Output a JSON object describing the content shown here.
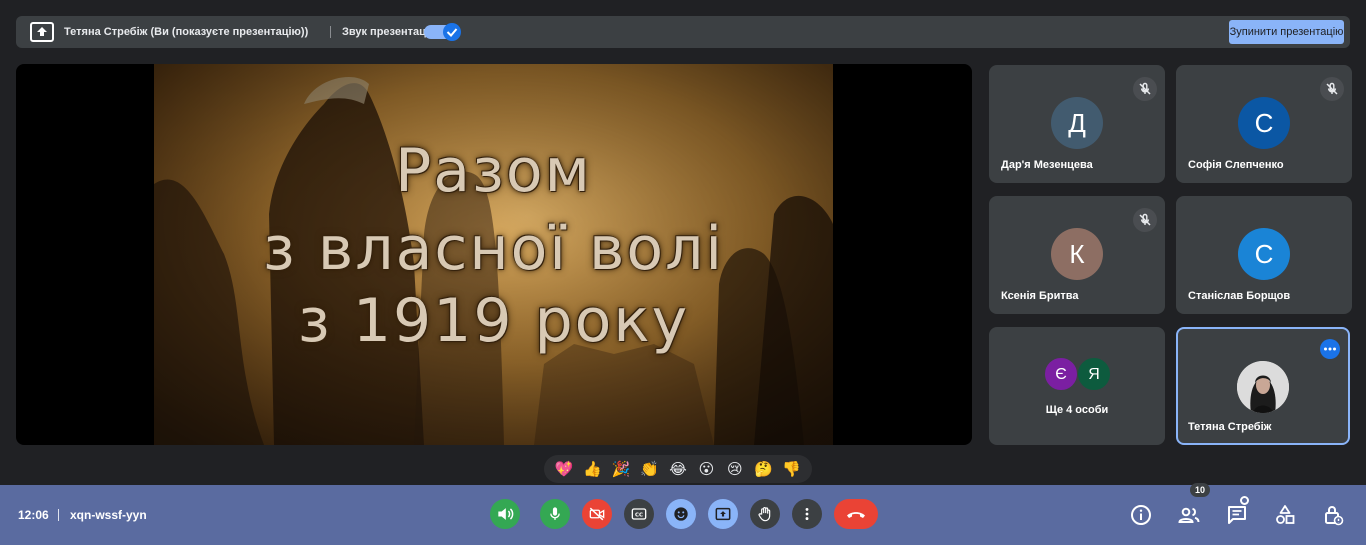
{
  "topbar": {
    "presenter_label": "Тетяна Стребіж (Ви (показуєте презентацію))",
    "sound_label": "Звук презентації",
    "sound_on": true,
    "stop_label": "Зупинити презентацію"
  },
  "slide": {
    "line1": "Разом",
    "line2": "з власної волі",
    "line3": "з 1919 року"
  },
  "participants": [
    {
      "initial": "Д",
      "name": "Дар'я Мезенцева",
      "avatar_color": "#425b6f",
      "muted": true
    },
    {
      "initial": "С",
      "name": "Софія Слепченко",
      "avatar_color": "#0b57a4",
      "muted": true
    },
    {
      "initial": "К",
      "name": "Ксенія Бритва",
      "avatar_color": "#8d6e63",
      "muted": true
    },
    {
      "initial": "С",
      "name": "Станіслав Борщов",
      "avatar_color": "#1a84d6",
      "muted": false
    }
  ],
  "more_tile": {
    "avatars": [
      {
        "initial": "Є",
        "color": "#7b1fa2"
      },
      {
        "initial": "Я",
        "color": "#0d5b3e"
      }
    ],
    "label": "Ще 4 особи"
  },
  "self_tile": {
    "name": "Тетяна Стребіж",
    "menu_icon": "more-horizontal-icon"
  },
  "reactions": [
    "💖",
    "👍",
    "🎉",
    "👏",
    "😂",
    "😮",
    "😢",
    "🤔",
    "👎"
  ],
  "bottombar": {
    "time": "12:06",
    "meeting_code": "xqn-wssf-yyn",
    "people_count": "10",
    "controls": [
      {
        "name": "speaker-button",
        "icon": "speaker-icon"
      },
      {
        "name": "mic-button",
        "icon": "mic-icon"
      },
      {
        "name": "camera-button",
        "icon": "camera-off-icon"
      },
      {
        "name": "captions-button",
        "icon": "captions-icon"
      },
      {
        "name": "reactions-button",
        "icon": "smiley-icon"
      },
      {
        "name": "present-button",
        "icon": "present-icon"
      },
      {
        "name": "raise-hand-button",
        "icon": "hand-icon"
      },
      {
        "name": "more-options-button",
        "icon": "more-vertical-icon"
      },
      {
        "name": "leave-call-button",
        "icon": "hang-up-icon"
      }
    ],
    "right_icons": [
      "info-icon",
      "people-icon",
      "chat-icon",
      "activities-icon",
      "host-controls-icon"
    ]
  },
  "colors": {
    "accent": "#8ab4f8",
    "bottom_bar": "#5a6ba0",
    "leave": "#ea4335",
    "speaker": "#34a853"
  }
}
